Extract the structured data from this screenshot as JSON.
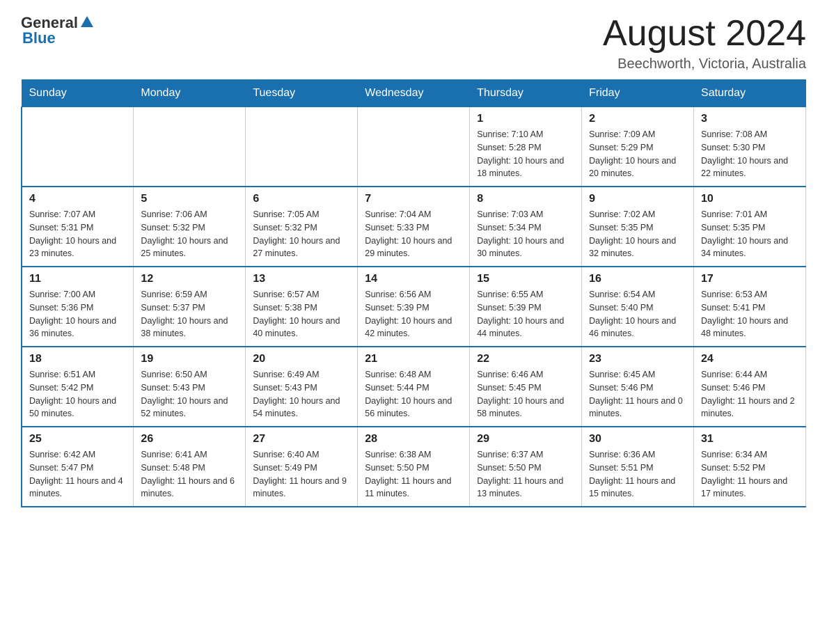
{
  "header": {
    "logo_general": "General",
    "logo_blue": "Blue",
    "month_title": "August 2024",
    "location": "Beechworth, Victoria, Australia"
  },
  "days_of_week": [
    "Sunday",
    "Monday",
    "Tuesday",
    "Wednesday",
    "Thursday",
    "Friday",
    "Saturday"
  ],
  "weeks": [
    [
      {
        "day": "",
        "info": ""
      },
      {
        "day": "",
        "info": ""
      },
      {
        "day": "",
        "info": ""
      },
      {
        "day": "",
        "info": ""
      },
      {
        "day": "1",
        "info": "Sunrise: 7:10 AM\nSunset: 5:28 PM\nDaylight: 10 hours and 18 minutes."
      },
      {
        "day": "2",
        "info": "Sunrise: 7:09 AM\nSunset: 5:29 PM\nDaylight: 10 hours and 20 minutes."
      },
      {
        "day": "3",
        "info": "Sunrise: 7:08 AM\nSunset: 5:30 PM\nDaylight: 10 hours and 22 minutes."
      }
    ],
    [
      {
        "day": "4",
        "info": "Sunrise: 7:07 AM\nSunset: 5:31 PM\nDaylight: 10 hours and 23 minutes."
      },
      {
        "day": "5",
        "info": "Sunrise: 7:06 AM\nSunset: 5:32 PM\nDaylight: 10 hours and 25 minutes."
      },
      {
        "day": "6",
        "info": "Sunrise: 7:05 AM\nSunset: 5:32 PM\nDaylight: 10 hours and 27 minutes."
      },
      {
        "day": "7",
        "info": "Sunrise: 7:04 AM\nSunset: 5:33 PM\nDaylight: 10 hours and 29 minutes."
      },
      {
        "day": "8",
        "info": "Sunrise: 7:03 AM\nSunset: 5:34 PM\nDaylight: 10 hours and 30 minutes."
      },
      {
        "day": "9",
        "info": "Sunrise: 7:02 AM\nSunset: 5:35 PM\nDaylight: 10 hours and 32 minutes."
      },
      {
        "day": "10",
        "info": "Sunrise: 7:01 AM\nSunset: 5:35 PM\nDaylight: 10 hours and 34 minutes."
      }
    ],
    [
      {
        "day": "11",
        "info": "Sunrise: 7:00 AM\nSunset: 5:36 PM\nDaylight: 10 hours and 36 minutes."
      },
      {
        "day": "12",
        "info": "Sunrise: 6:59 AM\nSunset: 5:37 PM\nDaylight: 10 hours and 38 minutes."
      },
      {
        "day": "13",
        "info": "Sunrise: 6:57 AM\nSunset: 5:38 PM\nDaylight: 10 hours and 40 minutes."
      },
      {
        "day": "14",
        "info": "Sunrise: 6:56 AM\nSunset: 5:39 PM\nDaylight: 10 hours and 42 minutes."
      },
      {
        "day": "15",
        "info": "Sunrise: 6:55 AM\nSunset: 5:39 PM\nDaylight: 10 hours and 44 minutes."
      },
      {
        "day": "16",
        "info": "Sunrise: 6:54 AM\nSunset: 5:40 PM\nDaylight: 10 hours and 46 minutes."
      },
      {
        "day": "17",
        "info": "Sunrise: 6:53 AM\nSunset: 5:41 PM\nDaylight: 10 hours and 48 minutes."
      }
    ],
    [
      {
        "day": "18",
        "info": "Sunrise: 6:51 AM\nSunset: 5:42 PM\nDaylight: 10 hours and 50 minutes."
      },
      {
        "day": "19",
        "info": "Sunrise: 6:50 AM\nSunset: 5:43 PM\nDaylight: 10 hours and 52 minutes."
      },
      {
        "day": "20",
        "info": "Sunrise: 6:49 AM\nSunset: 5:43 PM\nDaylight: 10 hours and 54 minutes."
      },
      {
        "day": "21",
        "info": "Sunrise: 6:48 AM\nSunset: 5:44 PM\nDaylight: 10 hours and 56 minutes."
      },
      {
        "day": "22",
        "info": "Sunrise: 6:46 AM\nSunset: 5:45 PM\nDaylight: 10 hours and 58 minutes."
      },
      {
        "day": "23",
        "info": "Sunrise: 6:45 AM\nSunset: 5:46 PM\nDaylight: 11 hours and 0 minutes."
      },
      {
        "day": "24",
        "info": "Sunrise: 6:44 AM\nSunset: 5:46 PM\nDaylight: 11 hours and 2 minutes."
      }
    ],
    [
      {
        "day": "25",
        "info": "Sunrise: 6:42 AM\nSunset: 5:47 PM\nDaylight: 11 hours and 4 minutes."
      },
      {
        "day": "26",
        "info": "Sunrise: 6:41 AM\nSunset: 5:48 PM\nDaylight: 11 hours and 6 minutes."
      },
      {
        "day": "27",
        "info": "Sunrise: 6:40 AM\nSunset: 5:49 PM\nDaylight: 11 hours and 9 minutes."
      },
      {
        "day": "28",
        "info": "Sunrise: 6:38 AM\nSunset: 5:50 PM\nDaylight: 11 hours and 11 minutes."
      },
      {
        "day": "29",
        "info": "Sunrise: 6:37 AM\nSunset: 5:50 PM\nDaylight: 11 hours and 13 minutes."
      },
      {
        "day": "30",
        "info": "Sunrise: 6:36 AM\nSunset: 5:51 PM\nDaylight: 11 hours and 15 minutes."
      },
      {
        "day": "31",
        "info": "Sunrise: 6:34 AM\nSunset: 5:52 PM\nDaylight: 11 hours and 17 minutes."
      }
    ]
  ]
}
